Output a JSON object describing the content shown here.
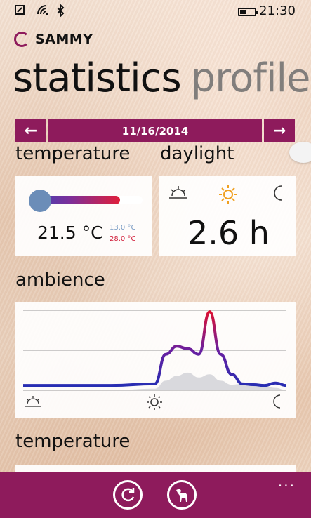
{
  "status_bar": {
    "time": "21:30",
    "icons": [
      "nfc-icon",
      "wifi-icon",
      "bluetooth-icon",
      "battery-icon"
    ]
  },
  "app": {
    "name": "SAMMY"
  },
  "pivot": {
    "active": "statistics",
    "inactive": "profile"
  },
  "date_nav": {
    "prev_label": "←",
    "date": "11/16/2014",
    "next_label": "→"
  },
  "temperature_card": {
    "label": "temperature",
    "value": "21.5 °C",
    "min": "13.0 °C",
    "max": "28.0 °C",
    "fill_fraction": 0.8
  },
  "daylight_card": {
    "label": "daylight",
    "value": "2.6 h",
    "icons": [
      "sunrise-icon",
      "sun-icon",
      "moon-icon"
    ]
  },
  "ambience_card": {
    "label": "ambience",
    "icons": [
      "sunrise-icon",
      "sun-icon",
      "moon-icon"
    ]
  },
  "temperature_section": {
    "label": "temperature"
  },
  "app_bar": {
    "refresh_icon": "refresh-icon",
    "dog_icon": "dog-icon",
    "more_label": "..."
  },
  "colors": {
    "accent": "#8e1b5c",
    "line_low": "#1f2fb5",
    "line_high": "#e0102e"
  },
  "chart_data": {
    "type": "area",
    "title": "",
    "xlabel": "",
    "ylabel": "",
    "x": [
      0,
      4,
      8,
      12,
      13,
      14,
      15,
      16,
      17,
      18,
      19,
      20,
      21,
      22,
      23,
      24
    ],
    "series": [
      {
        "values": [
          0.06,
          0.06,
          0.06,
          0.08,
          0.45,
          0.55,
          0.52,
          0.45,
          0.98,
          0.45,
          0.2,
          0.08,
          0.07,
          0.06,
          0.09,
          0.06
        ]
      },
      {
        "values": [
          0.0,
          0.0,
          0.0,
          0.02,
          0.12,
          0.18,
          0.22,
          0.16,
          0.2,
          0.12,
          0.07,
          0.08,
          0.07,
          0.05,
          0.03,
          0.0
        ]
      }
    ],
    "grid": true,
    "ylim": [
      0,
      1
    ]
  }
}
